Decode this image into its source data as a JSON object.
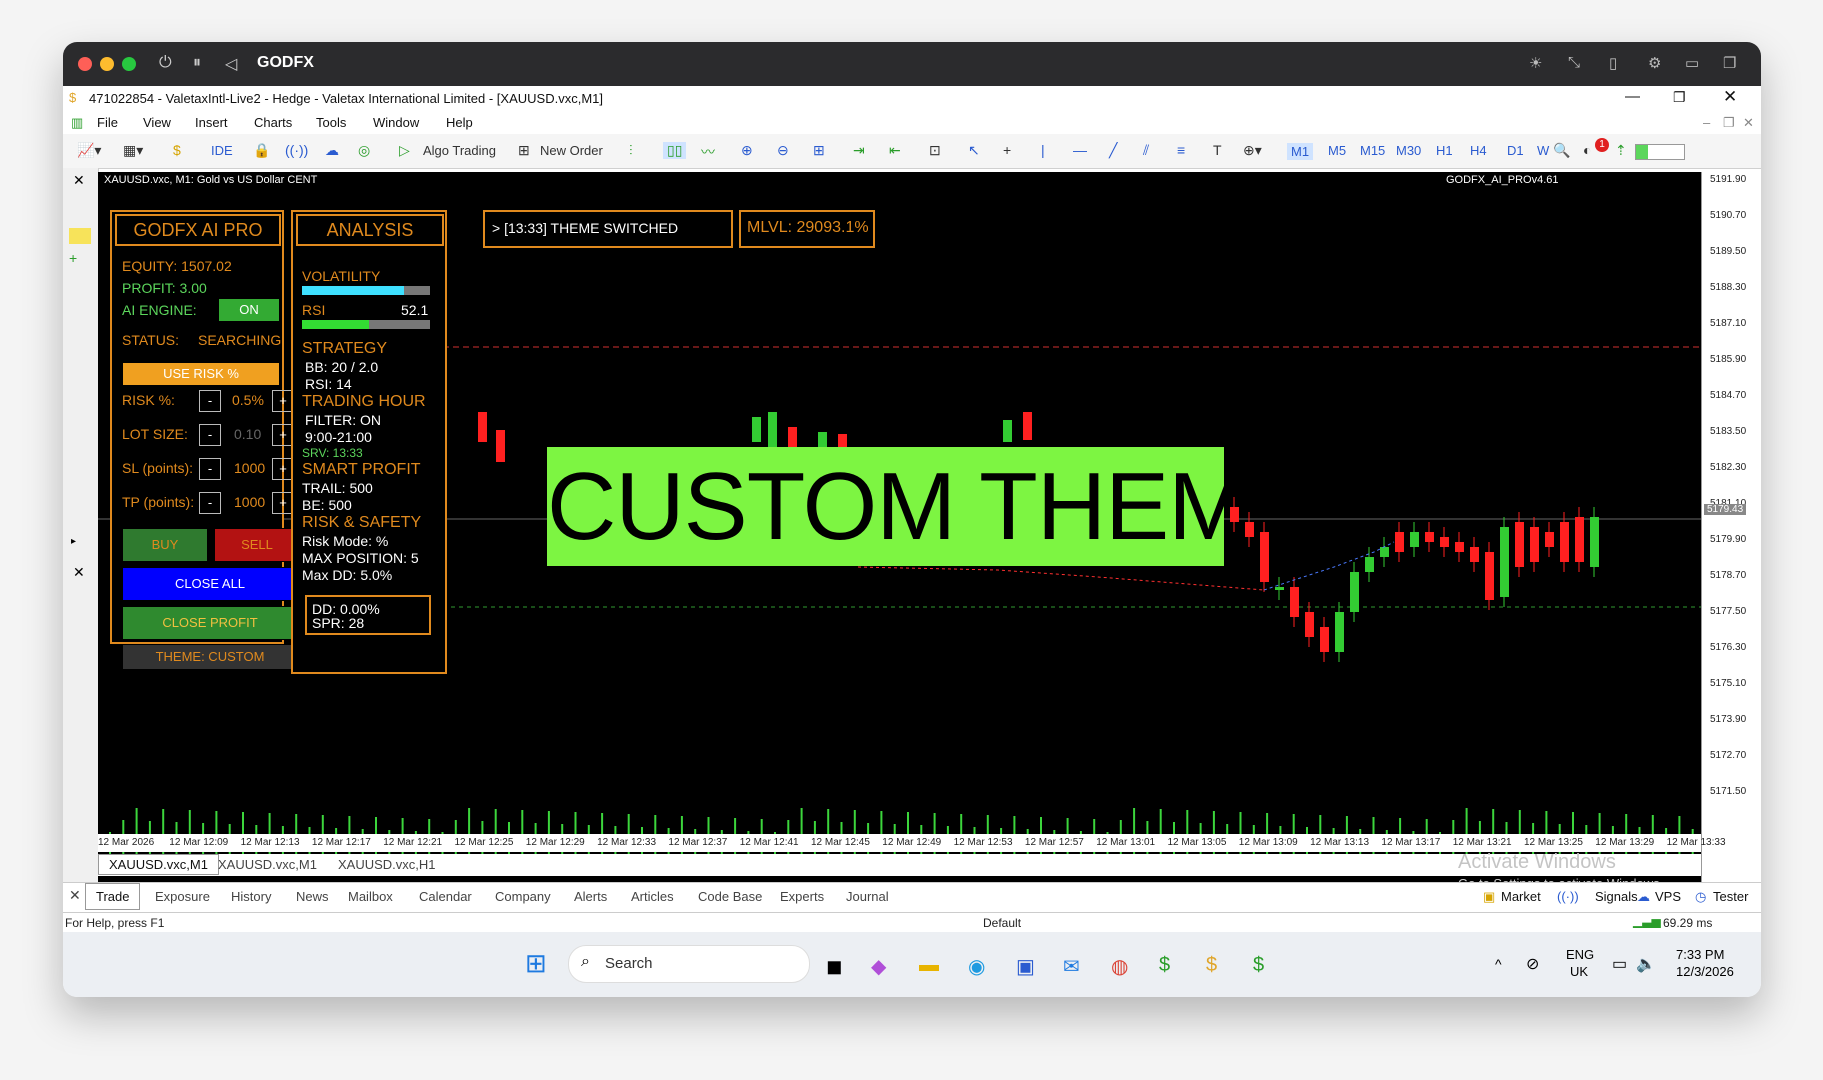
{
  "mac": {
    "title": "GODFX"
  },
  "window": {
    "title": "471022854 - ValetaxIntl-Live2 - Hedge - Valetax International Limited - [XAUUSD.vxc,M1]"
  },
  "menu": [
    "File",
    "View",
    "Insert",
    "Charts",
    "Tools",
    "Window",
    "Help"
  ],
  "toolbar": {
    "ide": "IDE",
    "algo": "Algo Trading",
    "new_order": "New Order",
    "timeframes": [
      "M1",
      "M5",
      "M15",
      "M30",
      "H1",
      "H4",
      "D1",
      "W"
    ],
    "notif_count": "1"
  },
  "chart": {
    "symbol_info": "XAUUSD.vxc, M1:  Gold vs US Dollar CENT",
    "ea_name": "GODFX_AI_PROv4.61",
    "overlay_text": "CUSTOM THEME",
    "log_text": "> [13:33] THEME SWITCHED",
    "mlvl": "MLVL: 29093.1%",
    "prices": [
      "5191.90",
      "5190.70",
      "5189.50",
      "5188.30",
      "5187.10",
      "5185.90",
      "5184.70",
      "5183.50",
      "5182.30",
      "5181.10",
      "5179.90",
      "5178.70",
      "5177.50",
      "5176.30",
      "5175.10",
      "5173.90",
      "5172.70",
      "5171.50"
    ],
    "current_price": "5179.43",
    "times": [
      "12 Mar 2026",
      "12 Mar 12:09",
      "12 Mar 12:13",
      "12 Mar 12:17",
      "12 Mar 12:21",
      "12 Mar 12:25",
      "12 Mar 12:29",
      "12 Mar 12:33",
      "12 Mar 12:37",
      "12 Mar 12:41",
      "12 Mar 12:45",
      "12 Mar 12:49",
      "12 Mar 12:53",
      "12 Mar 12:57",
      "12 Mar 13:01",
      "12 Mar 13:05",
      "12 Mar 13:09",
      "12 Mar 13:13",
      "12 Mar 13:17",
      "12 Mar 13:21",
      "12 Mar 13:25",
      "12 Mar 13:29",
      "12 Mar 13:33"
    ],
    "tabs": [
      "XAUUSD.vxc,M1",
      "XAUUSD.vxc,M1",
      "XAUUSD.vxc,H1"
    ],
    "watermark1": "Activate Windows",
    "watermark2": "Go to Settings to activate Windows."
  },
  "panel": {
    "title": "GODFX AI PRO",
    "equity": "EQUITY: 1507.02",
    "profit": "PROFIT: 3.00",
    "ai_engine_label": "AI ENGINE:",
    "ai_engine_state": "ON",
    "status_label": "STATUS:",
    "status_value": "SEARCHING",
    "use_risk": "USE RISK %",
    "risk_label": "RISK %:",
    "risk_value": "0.5%",
    "lot_label": "LOT SIZE:",
    "lot_value": "0.10",
    "sl_label": "SL (points):",
    "sl_value": "1000",
    "tp_label": "TP (points):",
    "tp_value": "1000",
    "minus": "-",
    "plus": "+",
    "buy": "BUY",
    "sell": "SELL",
    "close_all": "CLOSE ALL",
    "close_profit": "CLOSE PROFIT",
    "theme": "THEME: CUSTOM"
  },
  "analysis": {
    "title": "ANALYSIS",
    "volatility": "VOLATILITY",
    "volatility_level": 0.8,
    "rsi": "RSI",
    "rsi_value": "52.1",
    "rsi_level": 0.52,
    "strategy": "STRATEGY",
    "bb": "BB: 20 / 2.0",
    "rsi_p": "RSI: 14",
    "trading_hour": "TRADING HOUR",
    "filter": "FILTER: ON",
    "hours": "9:00-21:00",
    "srv": "SRV: 13:33",
    "smart_profit": "SMART PROFIT",
    "trail": "TRAIL: 500",
    "be": "BE: 500",
    "risk_safety": "RISK & SAFETY",
    "risk_mode": "Risk Mode: %",
    "max_pos": "MAX POSITION: 5",
    "max_dd": "Max DD: 5.0%",
    "dd": "DD: 0.00%",
    "spr": "SPR: 28"
  },
  "bottom_tabs": [
    "Trade",
    "Exposure",
    "History",
    "News",
    "Mailbox",
    "Calendar",
    "Company",
    "Alerts",
    "Articles",
    "Code Base",
    "Experts",
    "Journal"
  ],
  "bottom_right": [
    "Market",
    "Signals",
    "VPS",
    "Tester"
  ],
  "status": {
    "help": "For Help, press F1",
    "profile": "Default",
    "ping": "69.29 ms"
  },
  "taskbar": {
    "search": "Search",
    "lang1": "ENG",
    "lang2": "UK",
    "time": "7:33 PM",
    "date": "12/3/2026"
  },
  "colors": {
    "accent": "#e08a1e",
    "overlay_bg": "#7df542",
    "bull": "#33cc33",
    "bear": "#ff2020"
  }
}
